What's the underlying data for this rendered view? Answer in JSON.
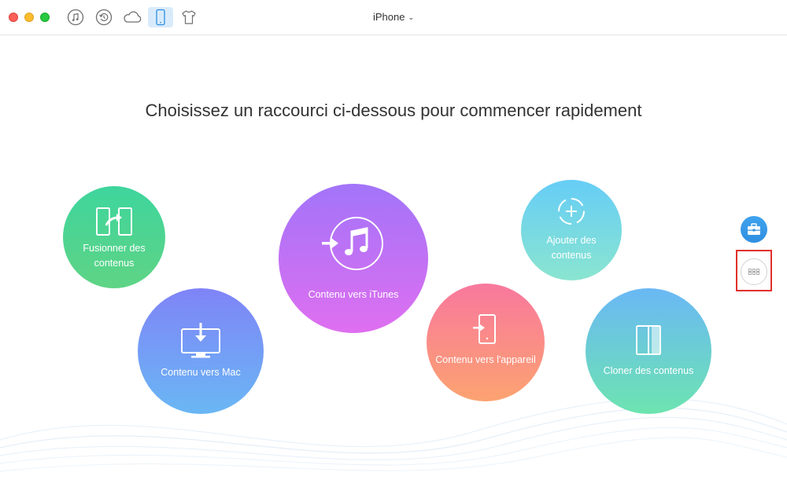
{
  "window": {
    "device_title": "iPhone"
  },
  "toolbar": {
    "buttons": [
      {
        "icon": "music-note-icon",
        "active": false
      },
      {
        "icon": "history-icon",
        "active": false
      },
      {
        "icon": "cloud-icon",
        "active": false
      },
      {
        "icon": "iphone-icon",
        "active": true
      },
      {
        "icon": "tshirt-icon",
        "active": false
      }
    ]
  },
  "main": {
    "headline": "Choisissez un raccourci ci-dessous pour commencer rapidement",
    "shortcuts": {
      "fusion": {
        "label_line1": "Fusionner des",
        "label_line2": "contenus",
        "icon": "merge-icon",
        "color": "#3ed59d"
      },
      "mac": {
        "label": "Contenu vers Mac",
        "icon": "monitor-download-icon",
        "color": "#7f84f7"
      },
      "itunes": {
        "label": "Contenu vers iTunes",
        "icon": "itunes-icon",
        "color": "#a274f9"
      },
      "device": {
        "label": "Contenu vers l'appareil",
        "icon": "phone-import-icon",
        "color": "#f8789d"
      },
      "add": {
        "label_line1": "Ajouter des",
        "label_line2": "contenus",
        "icon": "add-circle-icon",
        "color": "#66cdf6"
      },
      "clone": {
        "label": "Cloner des contenus",
        "icon": "clone-icon",
        "color": "#6ab8f5"
      }
    }
  },
  "side": {
    "toolbox_icon": "toolbox-icon",
    "grid_icon": "grid-icon",
    "highlight_color": "#e0302a"
  }
}
